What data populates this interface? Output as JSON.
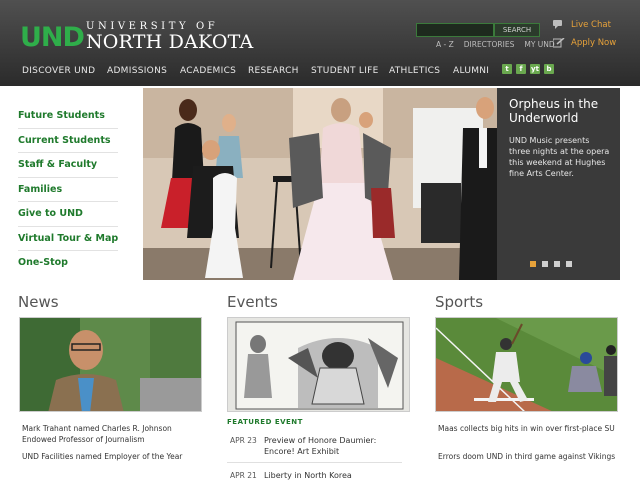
{
  "header": {
    "logo_und": "UND",
    "logo_university": "UNIVERSITY OF",
    "logo_north_dakota": "NORTH DAKOTA",
    "search_button": "SEARCH",
    "util_links": [
      "A - Z",
      "DIRECTORIES",
      "MY UND"
    ],
    "live_chat": "Live Chat",
    "apply_now": "Apply Now"
  },
  "nav": {
    "items": [
      "DISCOVER UND",
      "ADMISSIONS",
      "ACADEMICS",
      "RESEARCH",
      "STUDENT LIFE",
      "ATHLETICS",
      "ALUMNI"
    ],
    "social": [
      "t",
      "f",
      "yt",
      "b"
    ]
  },
  "sidebar": {
    "items": [
      "Future Students",
      "Current Students",
      "Staff & Faculty",
      "Families",
      "Give to UND",
      "Virtual Tour & Map",
      "One-Stop"
    ]
  },
  "hero": {
    "title": "Orpheus in the Underworld",
    "description": "UND Music presents three nights at the opera this weekend at Hughes fine Arts Center.",
    "slide_count": 4,
    "active_slide": 1
  },
  "news": {
    "heading": "News",
    "items": [
      "Mark Trahant named Charles R. Johnson Endowed Professor of Journalism",
      "UND Facilities named Employer of the Year"
    ]
  },
  "events": {
    "heading": "Events",
    "featured_label": "FEATURED EVENT",
    "items": [
      {
        "date": "APR 23",
        "title": "Preview of Honore Daumier: Encore! Art Exhibit"
      },
      {
        "date": "APR 21",
        "title": "Liberty in North Korea"
      }
    ]
  },
  "sports": {
    "heading": "Sports",
    "items": [
      "Maas collects big hits in win over first-place SU",
      "Errors doom UND in third game against Vikings"
    ]
  },
  "colors": {
    "brand_green": "#1f7a2c",
    "accent_orange": "#e7a23a",
    "header_dark": "#2b2b2b"
  }
}
